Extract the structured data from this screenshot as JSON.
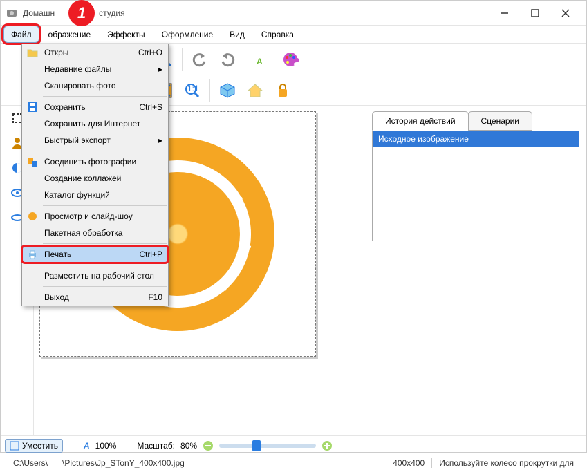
{
  "window": {
    "title_prefix": "Домашн",
    "title_suffix": "студия",
    "marker": "1"
  },
  "menubar": {
    "file": "Файл",
    "image": "ображение",
    "effects": "Эффекты",
    "design": "Оформление",
    "view": "Вид",
    "help": "Справка"
  },
  "file_menu": {
    "open": {
      "label": "Откры",
      "shortcut": "Ctrl+O"
    },
    "recent": {
      "label": "Недавние файлы"
    },
    "scan": {
      "label": "Сканировать фото"
    },
    "save": {
      "label": "Сохранить",
      "shortcut": "Ctrl+S"
    },
    "save_web": {
      "label": "Сохранить для Интернет"
    },
    "quick_export": {
      "label": "Быстрый экспорт"
    },
    "merge": {
      "label": "Соединить фотографии"
    },
    "collage": {
      "label": "Создание коллажей"
    },
    "catalog": {
      "label": "Каталог функций"
    },
    "slideshow": {
      "label": "Просмотр и слайд-шоу"
    },
    "batch": {
      "label": "Пакетная обработка"
    },
    "print": {
      "label": "Печать",
      "shortcut": "Ctrl+P"
    },
    "desktop": {
      "label": "Разместить на рабочий стол"
    },
    "exit": {
      "label": "Выход",
      "shortcut": "F10"
    }
  },
  "right_panel": {
    "tab_history": "История действий",
    "tab_scenarios": "Сценарии",
    "history_item": "Исходное изображение"
  },
  "status": {
    "fit": "Уместить",
    "text_icon": "А",
    "text_value": "100%",
    "zoom_label": "Масштаб:",
    "zoom_value": "80%"
  },
  "status2": {
    "path": "C:\\Users\\",
    "file": "\\Pictures\\Jp_STonY_400x400.jpg",
    "dims": "400x400",
    "hint": "Используйте колесо прокрутки для"
  }
}
